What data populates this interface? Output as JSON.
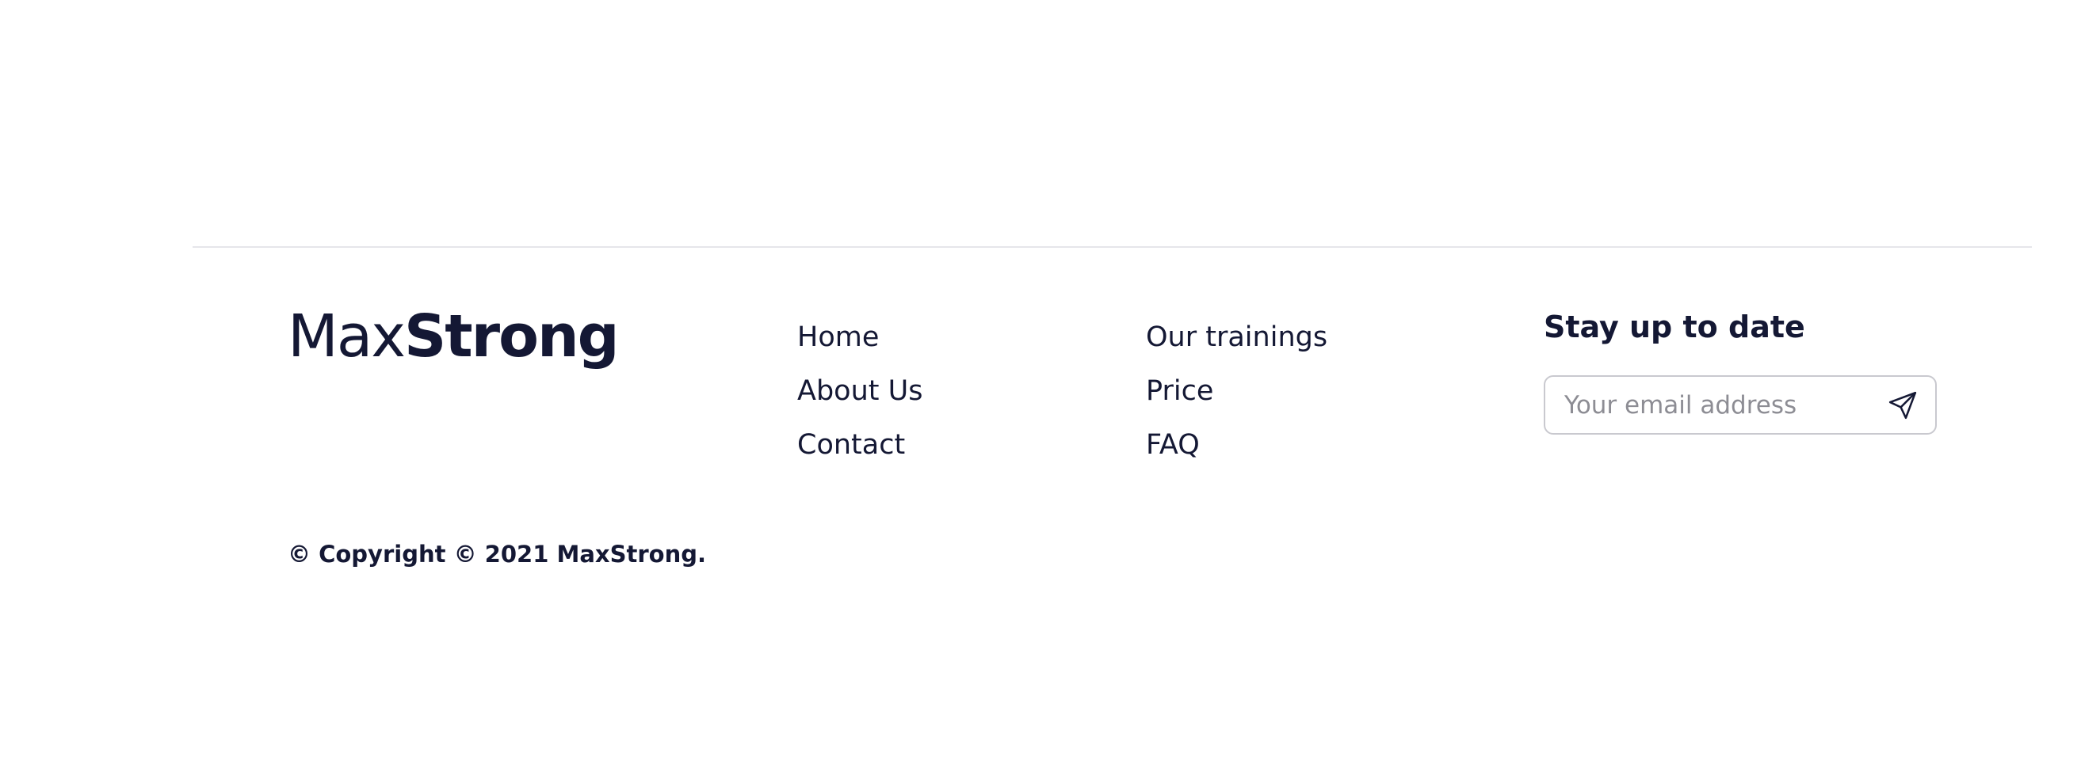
{
  "brand": {
    "logo_light": "Max",
    "logo_bold": "Strong",
    "text_color": "#141834"
  },
  "footer": {
    "nav_column_1": [
      {
        "label": "Home"
      },
      {
        "label": "About Us"
      },
      {
        "label": "Contact"
      }
    ],
    "nav_column_2": [
      {
        "label": "Our trainings"
      },
      {
        "label": "Price"
      },
      {
        "label": "FAQ"
      }
    ],
    "newsletter": {
      "title": "Stay up to date",
      "email_placeholder": "Your email address",
      "email_value": "",
      "send_icon": "paper-plane-icon"
    },
    "copyright": "© Copyright © 2021 MaxStrong."
  }
}
